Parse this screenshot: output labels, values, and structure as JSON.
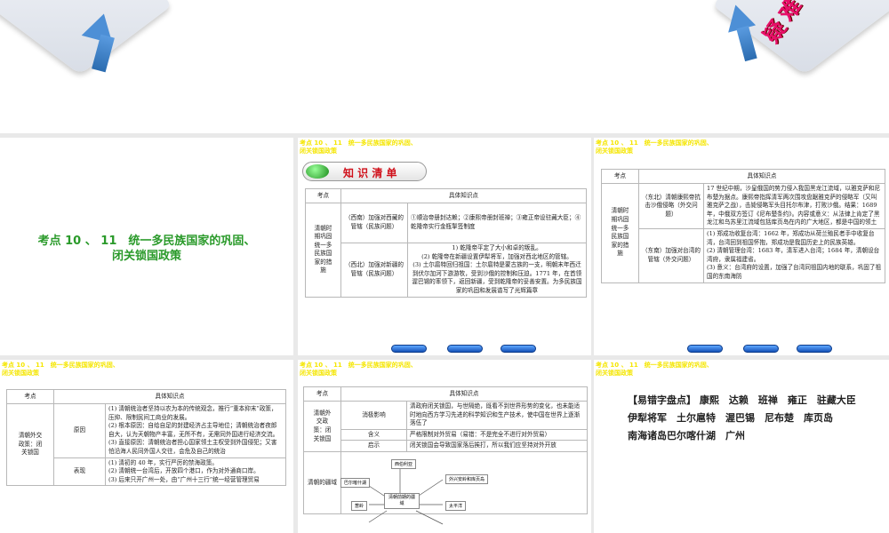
{
  "top_slide": {
    "badge_text": "疑难"
  },
  "header": "考点 10 、 11　统一多民族国家的巩固、闭关锁国政策",
  "header_line1": "考点 10 、 11　统一多民族国家的巩固、",
  "header_line2": "闭关锁国政策",
  "slide1": {
    "title_line1": "考点 10 、 11　统一多民族国家的巩固、",
    "title_line2": "闭关锁国政策"
  },
  "slide2": {
    "banner": "知 识 清 单",
    "col_headers": [
      "考点",
      "具体知识点"
    ],
    "topic": "清朝时期巩固统一多民族国家的措施",
    "rows": [
      {
        "sub": "（西南）加强对西藏的管辖（民族问题）",
        "detail": "①顺治帝册封达赖；②康熙帝册封班禅；③雍正帝设驻藏大臣；④乾隆帝实行金瓶掣签制度"
      },
      {
        "sub": "（西北）加强对新疆的管辖（民族问题）",
        "detail": "1) 乾隆帝平定了大小和卓的叛乱。\n(2) 乾隆帝在新疆设置伊犁将军，加强对西北地区的管辖。\n(3) 土尔扈特回归祖国：土尔扈特是蒙古族的一支，明朝末年西迁到伏尔加河下游游牧，受到沙俄的控制和压迫。1771 年，在首领渥巴锡的率领下，返回新疆，受到乾隆帝的妥善安置。为多民族国家的巩固和发展谱写了光辉篇章"
      }
    ]
  },
  "slide3": {
    "col_headers": [
      "考点",
      "具体知识点"
    ],
    "topic": "清朝时期巩固统一多民族国家的措施",
    "rows": [
      {
        "sub": "（东北）清朝康熙帝抗击沙俄侵略（外交问题）",
        "detail": "17 世纪中期，沙皇俄国的势力侵入我国黑龙江流域，以雅克萨和尼布楚为据点。康熙帝指挥清军两次围攻盘踞雅克萨的侵略军（又叫雅克萨之战），击毙侵略军头目托尔布津，打败沙俄。结果：1689 年，中俄双方签订《尼布楚条约》。内容或意义：从法律上肯定了黑龙江和乌苏里江流域包括库页岛在内的广大地区，都是中国的领土"
      },
      {
        "sub": "（东南）加强对台湾的管辖（外交问题）",
        "detail": "(1) 郑成功收复台湾：1662 年，郑成功从荷兰殖民者手中收复台湾，台湾回到祖国怀抱，郑成功是我国历史上的民族英雄。\n(2) 清朝管理台湾：1683 年，清军进入台湾；1684 年，清朝设台湾府，隶属福建省。\n(3) 意义：台湾府的设置，加强了台湾同祖国内地的联系，巩固了祖国的东南海防"
      }
    ]
  },
  "slide4": {
    "col_headers": [
      "考点",
      "具体知识点"
    ],
    "topic": "清朝外交政策：闭关锁国",
    "rows": [
      {
        "sub": "原因",
        "detail": "(1) 清朝统治者坚持以农为本的传统观念，推行“重本抑末”政策，压抑、限制民间工商业的发展。\n(2) 根本原因：自给自足的封建经济占主导地位；清朝统治者夜郎自大，认为天朝物产丰富，无所不有，无需同外国进行经济交流。\n(3) 直接原因：清朝统治者担心国家领土主权受到外国侵犯；又害怕沿海人民同外国人交往，会危及自己的统治"
      },
      {
        "sub": "表现",
        "detail": "(1) 清初的 40 年，实行严厉的禁海政策。\n(2) 清朝统一台湾后，开放四个港口，作为对外通商口岸。\n(3) 后来只开广州一处，由“广州十三行”统一经营管理贸易"
      }
    ]
  },
  "slide5": {
    "col_headers": [
      "考点",
      "具体知识点"
    ],
    "topic": "清朝外交政策：闭关锁国",
    "rows": [
      {
        "sub": "消极影响",
        "detail": "清政府闭关锁国，与世隔绝，既看不到世界形势的变化，也未能适时地向西方学习先进的科学知识和生产技术，使中国在世界上逐渐落伍了"
      },
      {
        "sub": "含义",
        "detail": "严格限制对外贸易（易错：不是完全不进行对外贸易）"
      },
      {
        "sub": "启示",
        "detail": "闭关锁国会导致国家落后挨打，所以我们应坚持对外开放"
      }
    ],
    "territory_topic": "清朝的疆域",
    "diagram": {
      "center": "清朝前期的疆域",
      "north": "西伯利亚",
      "northwest": "巴尔喀什湖",
      "west": "葱岭",
      "northeast": "外兴安岭和库页岛",
      "east": "太平洋"
    }
  },
  "slide6": {
    "lines": [
      "【易错字盘点】 康熙　达赖　班禅　雍正　驻藏大臣",
      "伊犁将军　土尔扈特　渥巴锡　尼布楚　库页岛",
      "南海诸岛巴尔喀什湖　广州"
    ]
  },
  "nav_buttons": [
    "",
    "",
    ""
  ]
}
